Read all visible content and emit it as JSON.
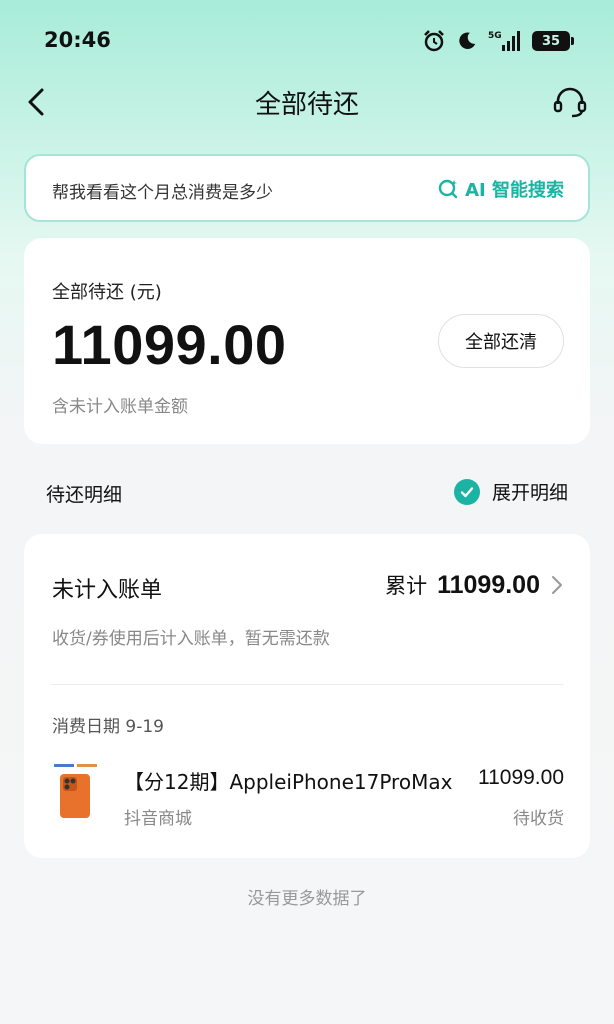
{
  "status_bar": {
    "time": "20:46",
    "network": "5G",
    "battery": "35"
  },
  "nav": {
    "title": "全部待还"
  },
  "search": {
    "placeholder": "帮我看看这个月总消费是多少",
    "ai_label": "AI 智能搜索"
  },
  "summary": {
    "label": "全部待还 (元)",
    "amount": "11099.00",
    "pay_all_label": "全部还清",
    "note": "含未计入账单金额"
  },
  "detail": {
    "header": "待还明细",
    "expand_label": "展开明细",
    "expand_checked": true
  },
  "bill": {
    "title": "未计入账单",
    "total_label": "累计",
    "total_amount": "11099.00",
    "description": "收货/券使用后计入账单，暂无需还款",
    "date": "消费日期 9-19",
    "item": {
      "title": "【分12期】AppleiPhone17ProMax",
      "amount": "11099.00",
      "shop": "抖音商城",
      "status": "待收货"
    }
  },
  "footer": {
    "no_more": "没有更多数据了"
  },
  "colors": {
    "accent": "#1bb3a4",
    "header_gradient": "#a8ecd9",
    "background": "#f5f6f7"
  }
}
